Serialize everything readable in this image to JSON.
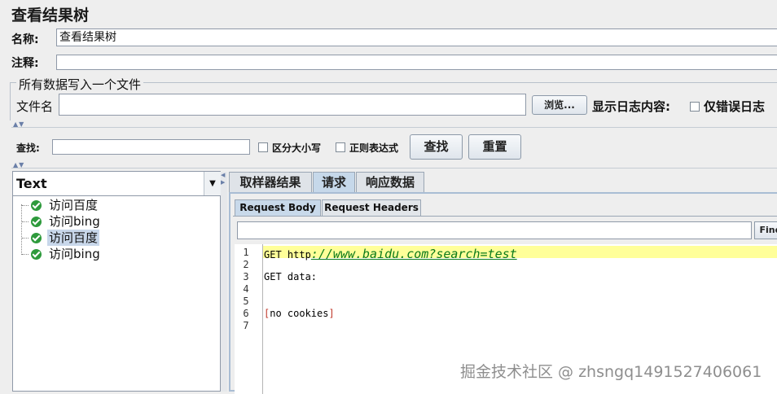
{
  "window": {
    "title": "查看结果树"
  },
  "name_row": {
    "label": "名称:",
    "value": "查看结果树"
  },
  "comment_row": {
    "label": "注释:",
    "value": ""
  },
  "file_group": {
    "legend": "所有数据写入一个文件",
    "file_label": "文件名",
    "file_value": "",
    "browse_label": "浏览...",
    "log_label": "显示日志内容:",
    "errors_only_label": "仅错误日志"
  },
  "search": {
    "label": "查找:",
    "value": "",
    "case_label": "区分大小写",
    "regex_label": "正则表达式",
    "find_button": "查找",
    "reset_button": "重置"
  },
  "renderer": {
    "selected": "Text"
  },
  "tree": {
    "items": [
      {
        "label": "访问百度",
        "status": "success",
        "selected": false
      },
      {
        "label": "访问bing",
        "status": "success",
        "selected": false
      },
      {
        "label": "访问百度",
        "status": "success",
        "selected": true
      },
      {
        "label": "访问bing",
        "status": "success",
        "selected": false
      }
    ]
  },
  "result_tabs": {
    "tabs": [
      "取样器结果",
      "请求",
      "响应数据"
    ],
    "active": "请求"
  },
  "request_tabs": {
    "tabs": [
      "Request Body",
      "Request Headers"
    ],
    "active": "Request Body"
  },
  "editor": {
    "find_label": "Find",
    "search_value": "",
    "lines": [
      {
        "n": "1",
        "text": "GET http",
        "rest": "://www.baidu.com?search=test"
      },
      {
        "n": "2",
        "text": ""
      },
      {
        "n": "3",
        "text": "GET data:"
      },
      {
        "n": "4",
        "text": ""
      },
      {
        "n": "5",
        "text": ""
      },
      {
        "n": "6",
        "text": "[no cookies]"
      },
      {
        "n": "7",
        "text": ""
      }
    ]
  },
  "watermark": "掘金技术社区 @ zhsngq1491527406061",
  "colors": {
    "highlight_line": "#ffff99",
    "url": "#0b7a1a",
    "selection": "#c8d7ea",
    "active_tab": "#c6d8ea"
  }
}
